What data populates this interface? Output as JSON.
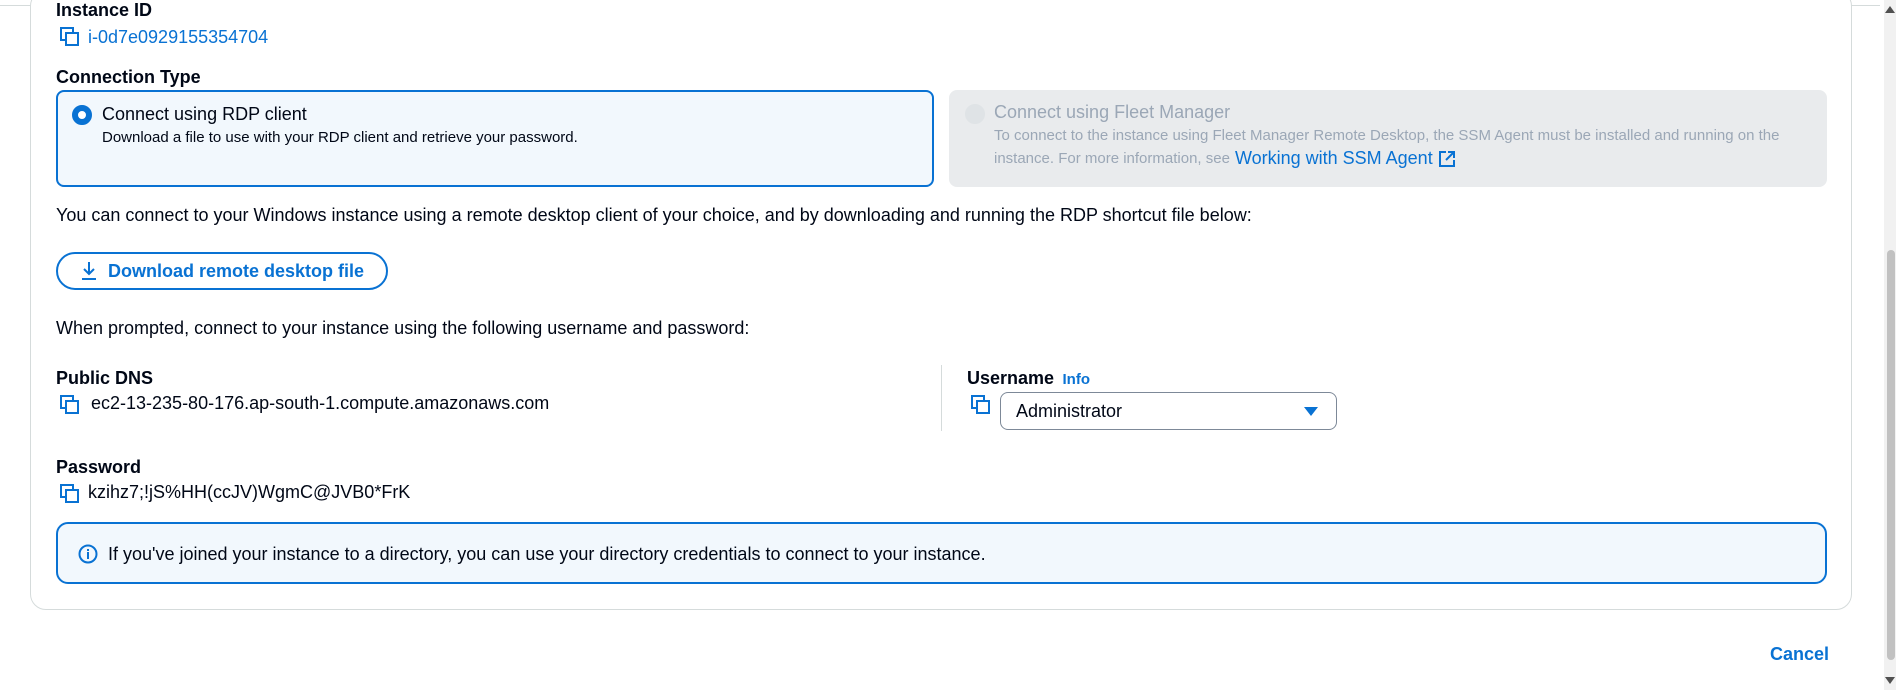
{
  "instance": {
    "label": "Instance ID",
    "value": "i-0d7e0929155354704"
  },
  "connection_type": {
    "label": "Connection Type",
    "rdp": {
      "title": "Connect using RDP client",
      "description": "Download a file to use with your RDP client and retrieve your password.",
      "selected": true
    },
    "fleet": {
      "title": "Connect using Fleet Manager",
      "description_line1": "To connect to the instance using Fleet Manager Remote Desktop, the SSM Agent must be installed and running on the",
      "description_line2": "instance. For more information, see",
      "link": "Working with SSM Agent",
      "disabled": true
    }
  },
  "intro_text": "You can connect to your Windows instance using a remote desktop client of your choice, and by downloading and running the RDP shortcut file below:",
  "download_button": "Download remote desktop file",
  "prompt_text": "When prompted, connect to your instance using the following username and password:",
  "public_dns": {
    "label": "Public DNS",
    "value": "ec2-13-235-80-176.ap-south-1.compute.amazonaws.com"
  },
  "username": {
    "label": "Username",
    "info": "Info",
    "value": "Administrator"
  },
  "password": {
    "label": "Password",
    "value": "kzihz7;!jS%HH(ccJV)WgmC@JVB0*FrK"
  },
  "info_alert": "If you've joined your instance to a directory, you can use your directory credentials to connect to your instance.",
  "cancel": "Cancel",
  "colors": {
    "accent": "#0972d3",
    "selected_bg": "#f2f8fd",
    "disabled_bg": "#e9ebed",
    "disabled_text": "#9ba7b6"
  },
  "icons": [
    "copy-icon",
    "external-link-icon",
    "download-icon",
    "info-icon",
    "caret-down-icon"
  ]
}
